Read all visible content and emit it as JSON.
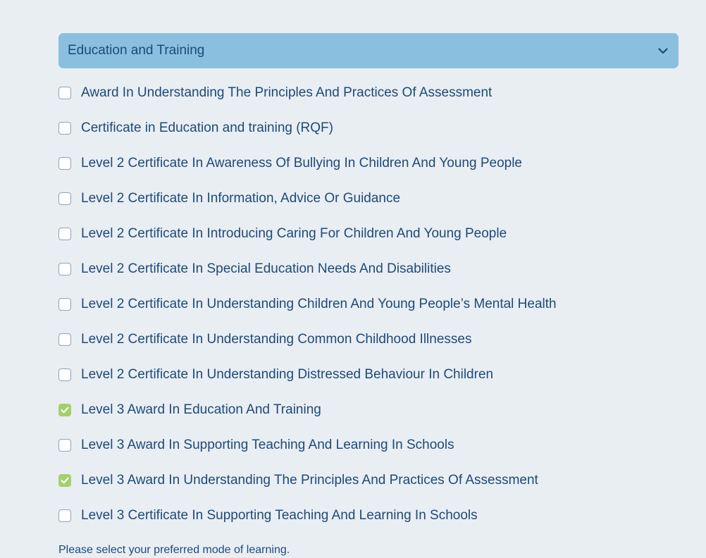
{
  "dropdown": {
    "selected": "Education and Training",
    "icon": "chevron-down-icon"
  },
  "options": [
    {
      "label": "Award In Understanding The Principles And Practices Of Assessment",
      "checked": false
    },
    {
      "label": "Certificate in Education and training (RQF)",
      "checked": false
    },
    {
      "label": "Level 2 Certificate In Awareness Of Bullying In Children And Young People",
      "checked": false
    },
    {
      "label": "Level 2 Certificate In Information, Advice Or Guidance",
      "checked": false
    },
    {
      "label": "Level 2 Certificate In Introducing Caring For Children And Young People",
      "checked": false
    },
    {
      "label": "Level 2 Certificate In Special Education Needs And Disabilities",
      "checked": false
    },
    {
      "label": "Level 2 Certificate In Understanding Children And Young People’s Mental Health",
      "checked": false
    },
    {
      "label": "Level 2 Certificate In Understanding Common Childhood Illnesses",
      "checked": false
    },
    {
      "label": "Level 2 Certificate In Understanding Distressed Behaviour In Children",
      "checked": false
    },
    {
      "label": "Level 3 Award In Education And Training",
      "checked": true
    },
    {
      "label": "Level 3 Award In Supporting Teaching And Learning In Schools",
      "checked": false
    },
    {
      "label": "Level 3 Award In Understanding The Principles And Practices Of Assessment",
      "checked": true
    },
    {
      "label": "Level 3 Certificate In Supporting Teaching And Learning In Schools",
      "checked": false
    }
  ],
  "hint": "Please select your preferred mode of learning.",
  "colors": {
    "background": "#e9eef3",
    "dropdown_bg": "#8bbfdf",
    "text": "#1d4a78",
    "checked": "#a4d06a"
  }
}
